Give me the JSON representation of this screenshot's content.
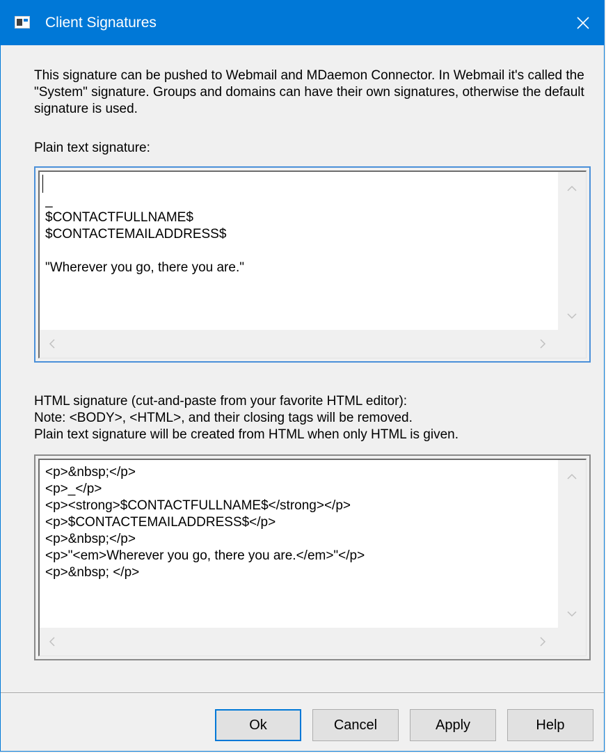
{
  "window": {
    "title": "Client Signatures",
    "title_icon": "window-app-icon",
    "close_icon": "close-icon"
  },
  "description": "This signature can be pushed to Webmail and MDaemon Connector.  In Webmail it's called the \"System\" signature.  Groups and domains can have their own signatures, otherwise the default signature is used.",
  "plain": {
    "label": "Plain text signature:",
    "text": "\n_\n$CONTACTFULLNAME$\n$CONTACTEMAILADDRESS$\n\n\"Wherever you go, there you are.\""
  },
  "html": {
    "label_lines": [
      "HTML signature (cut-and-paste from your favorite HTML editor):",
      "Note: <BODY>, <HTML>, and their closing tags will be removed.",
      "Plain text signature will be created from HTML when only HTML is given."
    ],
    "text": "<p>&nbsp;</p>\n<p>_</p>\n<p><strong>$CONTACTFULLNAME$</strong></p>\n<p>$CONTACTEMAILADDRESS$</p>\n<p>&nbsp;</p>\n<p>\"<em>Wherever you go, there you are.</em>\"</p>\n<p>&nbsp; </p>"
  },
  "buttons": {
    "ok": "Ok",
    "cancel": "Cancel",
    "apply": "Apply",
    "help": "Help"
  },
  "colors": {
    "titlebar": "#0078d7",
    "focus_border": "#4a90d9"
  }
}
